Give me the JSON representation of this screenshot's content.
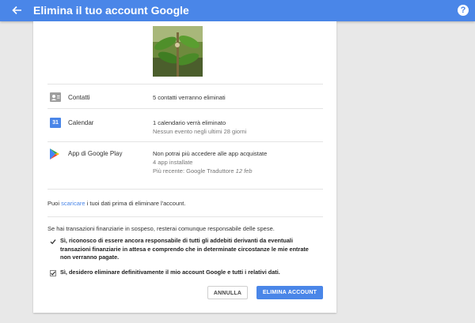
{
  "appbar": {
    "title": "Elimina il tuo account Google",
    "help_glyph": "?"
  },
  "items": [
    {
      "label": "Contatti",
      "main": "5 contatti verranno eliminati",
      "icon": "contacts-icon"
    },
    {
      "label": "Calendar",
      "main": "1 calendario verrà eliminato",
      "sub": "Nessun evento negli ultimi 28 giorni",
      "icon": "calendar-icon",
      "icon_text": "31"
    },
    {
      "label": "App di Google Play",
      "main": "Non potrai più accedere alle app acquistate",
      "sub1": "4 app installate",
      "sub2_prefix": "Più recente: Google Traduttore ",
      "sub2_date": "12 feb",
      "icon": "google-play-icon"
    }
  ],
  "download": {
    "prefix": "Puoi ",
    "link": "scaricare",
    "suffix": " i tuoi dati prima di eliminare l'account."
  },
  "notice": "Se hai transazioni finanziarie in sospeso, resterai comunque responsabile delle spese.",
  "checkboxes": [
    {
      "checked": true,
      "text": "Sì, riconosco di essere ancora responsabile di tutti gli addebiti derivanti da eventuali transazioni finanziarie in attesa e comprendo che in determinate circostanze le mie entrate non verranno pagate."
    },
    {
      "checked": true,
      "text": "Sì, desidero eliminare definitivamente il mio account Google e tutti i relativi dati."
    }
  ],
  "buttons": {
    "cancel": "ANNULLA",
    "delete": "ELIMINA ACCOUNT"
  },
  "colors": {
    "accent": "#4a86e8"
  }
}
